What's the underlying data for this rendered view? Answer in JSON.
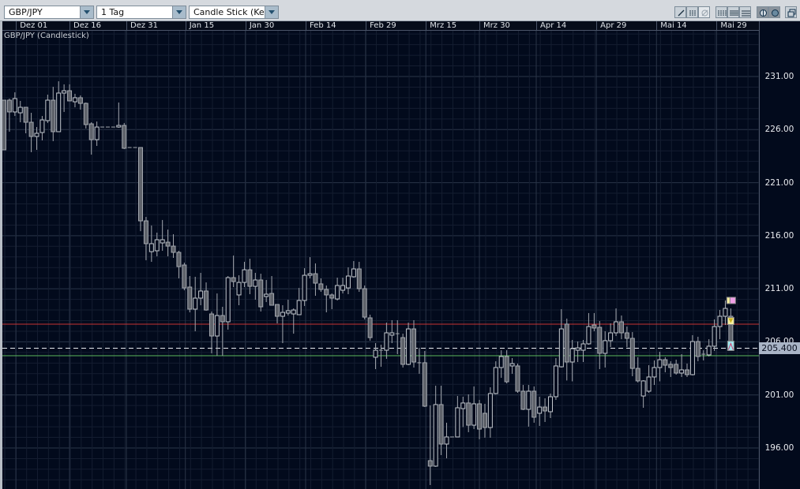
{
  "toolbar": {
    "symbol": "GBP/JPY",
    "interval": "1 Tag",
    "chart_type": "Candle Stick (Kerze",
    "tools": [
      "line-tool-icon",
      "horizontal-lines-icon",
      "disabled-circle-icon",
      "grid-lines-icon",
      "lines-icon",
      "dashed-lines-icon",
      "circle-settings-icon",
      "pattern-circle-icon",
      "detach-window-icon"
    ]
  },
  "chart_title": "GBP/JPY (Candlestick)",
  "colors": {
    "background": "#020a1c",
    "red_line": "#c83232",
    "green_line": "#5cb85c",
    "last_price_box": "#a9b4c6",
    "marker_pink": "#f0a0e8",
    "marker_yellow": "#f8f0a0",
    "marker_cyan": "#a0e8f0"
  },
  "chart_data": {
    "type": "candlestick",
    "title": "GBP/JPY (Candlestick)",
    "ylim": [
      191.5,
      235.0
    ],
    "y_ticks": [
      "231.00",
      "226.00",
      "221.00",
      "216.00",
      "211.00",
      "206.00",
      "201.00",
      "196.00"
    ],
    "x_ticks": [
      {
        "label": "Dez 01",
        "candle_index": 2.2
      },
      {
        "label": "Dez 16",
        "candle_index": 12
      },
      {
        "label": "Dez 31",
        "candle_index": 22.4
      },
      {
        "label": "Jan 15",
        "candle_index": 33.2
      },
      {
        "label": "Jan 30",
        "candle_index": 44.2
      },
      {
        "label": "Feb 14",
        "candle_index": 55.2
      },
      {
        "label": "Feb 29",
        "candle_index": 66.2
      },
      {
        "label": "Mrz 15",
        "candle_index": 77.2
      },
      {
        "label": "Mrz 30",
        "candle_index": 87
      },
      {
        "label": "Apr 14",
        "candle_index": 97.4
      },
      {
        "label": "Apr 29",
        "candle_index": 108.4
      },
      {
        "label": "Mai 14",
        "candle_index": 119.4
      },
      {
        "label": "Mai 29",
        "candle_index": 130.4
      }
    ],
    "last_price": "205.400",
    "last_price_value": 205.4,
    "horizontal_lines": [
      {
        "price": 207.67,
        "color": "red"
      },
      {
        "price": 204.69,
        "color": "green"
      }
    ],
    "markers": [
      {
        "price": 209.9,
        "color": "pink"
      },
      {
        "price": 208.0,
        "color": "yellow"
      },
      {
        "price": 205.7,
        "color": "cyan"
      }
    ],
    "ohlc": [
      [
        228.77,
        228.77,
        224.09,
        224.09
      ],
      [
        228.77,
        228.92,
        225.8,
        227.66
      ],
      [
        227.66,
        229.51,
        227.28,
        228.92
      ],
      [
        227.58,
        228.7,
        226.69,
        228.1
      ],
      [
        228.1,
        228.1,
        225.65,
        226.69
      ],
      [
        226.69,
        227.58,
        223.87,
        225.35
      ],
      [
        225.35,
        226.24,
        224.09,
        225.65
      ],
      [
        225.72,
        227.28,
        224.98,
        226.91
      ],
      [
        226.84,
        229.29,
        226.62,
        228.77
      ],
      [
        228.77,
        230.03,
        224.91,
        225.8
      ],
      [
        225.8,
        230.55,
        225.8,
        229.44
      ],
      [
        229.44,
        230.26,
        227.66,
        229.66
      ],
      [
        229.66,
        230.26,
        228.7,
        228.7
      ],
      [
        228.62,
        229.37,
        228.1,
        229.0
      ],
      [
        229.0,
        229.22,
        227.88,
        228.47
      ],
      [
        228.47,
        228.55,
        226.1,
        226.47
      ],
      [
        226.54,
        226.69,
        223.64,
        225.05
      ],
      [
        225.05,
        226.76,
        224.46,
        226.24
      ],
      [
        226.24,
        226.24,
        226.24,
        226.24
      ],
      [
        226.24,
        226.24,
        226.24,
        226.24
      ],
      [
        226.24,
        226.24,
        226.24,
        226.24
      ],
      [
        226.24,
        228.55,
        226.17,
        226.39
      ],
      [
        226.39,
        226.62,
        224.16,
        224.24
      ],
      [
        224.31,
        224.31,
        224.31,
        224.31
      ],
      [
        224.31,
        224.31,
        224.31,
        224.31
      ],
      [
        224.31,
        224.31,
        216.43,
        217.4
      ],
      [
        217.4,
        217.77,
        213.69,
        215.25
      ],
      [
        214.5,
        216.96,
        213.54,
        215.25
      ],
      [
        214.58,
        216.29,
        214.06,
        215.62
      ],
      [
        215.32,
        217.48,
        214.58,
        215.62
      ],
      [
        215.39,
        216.58,
        214.06,
        215.02
      ],
      [
        215.02,
        216.14,
        213.91,
        214.43
      ],
      [
        214.43,
        214.58,
        211.98,
        213.09
      ],
      [
        213.24,
        213.46,
        210.86,
        211.08
      ],
      [
        211.16,
        212.2,
        208.78,
        209.08
      ],
      [
        209.08,
        212.13,
        207.0,
        210.12
      ],
      [
        210.12,
        212.5,
        209.45,
        210.79
      ],
      [
        210.79,
        211.6,
        208.93,
        209.0
      ],
      [
        208.63,
        208.86,
        204.92,
        206.55
      ],
      [
        206.55,
        210.56,
        204.69,
        208.48
      ],
      [
        208.48,
        209.3,
        204.69,
        207.89
      ],
      [
        207.89,
        212.2,
        207.15,
        212.05
      ],
      [
        212.05,
        214.13,
        211.16,
        211.68
      ],
      [
        210.42,
        212.27,
        209.45,
        211.6
      ],
      [
        211.6,
        213.54,
        211.16,
        212.79
      ],
      [
        212.79,
        213.83,
        210.49,
        211.23
      ],
      [
        211.23,
        212.5,
        209.97,
        211.83
      ],
      [
        211.83,
        212.42,
        208.86,
        209.3
      ],
      [
        210.27,
        211.83,
        209.75,
        210.49
      ],
      [
        210.56,
        212.2,
        209.45,
        209.45
      ],
      [
        209.52,
        209.52,
        207.74,
        208.41
      ],
      [
        208.41,
        209.45,
        205.88,
        208.78
      ],
      [
        208.71,
        209.97,
        208.48,
        208.93
      ],
      [
        208.63,
        209.15,
        206.77,
        209.0
      ],
      [
        208.56,
        211.08,
        208.56,
        209.9
      ],
      [
        209.9,
        212.94,
        209.38,
        212.27
      ],
      [
        212.27,
        213.98,
        211.98,
        212.42
      ],
      [
        212.42,
        213.39,
        210.34,
        211.53
      ],
      [
        211.46,
        211.98,
        210.71,
        210.94
      ],
      [
        210.94,
        211.31,
        208.78,
        210.42
      ],
      [
        210.42,
        210.56,
        209.08,
        210.12
      ],
      [
        210.04,
        212.05,
        209.9,
        211.31
      ],
      [
        210.86,
        212.05,
        210.56,
        211.31
      ],
      [
        211.08,
        213.02,
        210.49,
        212.2
      ],
      [
        212.13,
        213.61,
        212.05,
        212.87
      ],
      [
        212.87,
        213.54,
        210.71,
        211.01
      ],
      [
        211.01,
        211.31,
        208.11,
        208.33
      ],
      [
        208.26,
        208.56,
        206.11,
        206.4
      ],
      [
        204.55,
        205.88,
        203.43,
        205.21
      ],
      [
        205.21,
        205.73,
        203.65,
        205.21
      ],
      [
        205.21,
        207.81,
        204.4,
        206.85
      ],
      [
        206.63,
        208.04,
        205.88,
        206.85
      ],
      [
        206.77,
        208.04,
        204.84,
        206.77
      ],
      [
        206.4,
        206.77,
        203.58,
        203.88
      ],
      [
        203.88,
        207.81,
        203.8,
        207.22
      ],
      [
        207.22,
        208.04,
        203.58,
        204.1
      ],
      [
        204.03,
        205.43,
        202.99,
        204.03
      ],
      [
        204.03,
        205.14,
        199.86,
        199.94
      ],
      [
        194.81,
        200.01,
        192.51,
        194.29
      ],
      [
        194.29,
        201.87,
        194.22,
        200.09
      ],
      [
        200.09,
        201.87,
        195.33,
        196.37
      ],
      [
        196.37,
        198.38,
        195.03,
        197.04
      ],
      [
        197.04,
        197.04,
        197.04,
        197.04
      ],
      [
        197.04,
        200.9,
        197.04,
        199.79
      ],
      [
        199.71,
        200.83,
        197.97,
        200.24
      ],
      [
        200.24,
        201.05,
        197.49,
        198.15
      ],
      [
        198.15,
        201.8,
        197.78,
        200.16
      ],
      [
        200.16,
        200.53,
        196.82,
        197.78
      ],
      [
        199.27,
        200.16,
        196.97,
        197.93
      ],
      [
        197.93,
        201.72,
        196.97,
        201.13
      ],
      [
        201.13,
        204.17,
        201.05,
        203.58
      ],
      [
        203.58,
        205.21,
        202.61,
        204.62
      ],
      [
        204.62,
        205.21,
        202.09,
        202.24
      ],
      [
        203.73,
        204.47,
        202.99,
        203.95
      ],
      [
        203.73,
        203.95,
        201.2,
        201.35
      ],
      [
        201.35,
        201.94,
        199.57,
        199.64
      ],
      [
        199.64,
        201.94,
        198.01,
        201.35
      ],
      [
        201.35,
        201.8,
        198.38,
        198.9
      ],
      [
        199.27,
        200.83,
        198.08,
        199.86
      ],
      [
        199.86,
        200.68,
        198.45,
        199.49
      ],
      [
        199.42,
        201.13,
        198.82,
        200.83
      ],
      [
        200.83,
        204.47,
        200.53,
        203.73
      ],
      [
        203.65,
        209.08,
        203.58,
        207.22
      ],
      [
        207.67,
        208.19,
        202.36,
        204.1
      ],
      [
        204.1,
        206.18,
        202.28,
        205.36
      ],
      [
        205.21,
        206.03,
        204.1,
        205.43
      ],
      [
        205.21,
        206.18,
        204.1,
        205.81
      ],
      [
        205.81,
        208.71,
        205.73,
        207.44
      ],
      [
        207.59,
        208.71,
        207.0,
        207.3
      ],
      [
        207.37,
        207.96,
        203.43,
        204.92
      ],
      [
        204.92,
        207.0,
        203.58,
        206.11
      ],
      [
        206.11,
        207.74,
        205.51,
        206.85
      ],
      [
        206.85,
        209.15,
        206.55,
        207.89
      ],
      [
        207.89,
        208.48,
        206.25,
        206.85
      ],
      [
        206.85,
        207.44,
        205.51,
        206.33
      ],
      [
        206.33,
        206.92,
        202.76,
        203.5
      ],
      [
        203.5,
        204.55,
        202.17,
        202.32
      ],
      [
        200.9,
        202.39,
        199.79,
        202.32
      ],
      [
        201.35,
        203.8,
        201.2,
        202.69
      ],
      [
        202.69,
        204.25,
        201.94,
        203.58
      ],
      [
        203.58,
        205.06,
        202.28,
        204.32
      ],
      [
        204.32,
        204.55,
        203.13,
        203.8
      ],
      [
        203.88,
        204.17,
        202.69,
        203.58
      ],
      [
        203.88,
        204.32,
        202.91,
        203.06
      ],
      [
        203.06,
        204.84,
        202.69,
        203.36
      ],
      [
        203.36,
        203.95,
        202.69,
        202.91
      ],
      [
        202.91,
        206.63,
        202.84,
        206.03
      ],
      [
        206.03,
        206.48,
        204.17,
        204.62
      ],
      [
        204.84,
        205.21,
        204.25,
        204.84
      ],
      [
        204.77,
        206.25,
        204.62,
        205.59
      ],
      [
        205.59,
        208.11,
        205.14,
        207.44
      ],
      [
        207.44,
        209.0,
        206.25,
        208.41
      ],
      [
        208.41,
        209.9,
        207.59,
        209.15
      ],
      [
        208.41,
        209.15,
        205.36,
        205.4
      ]
    ]
  }
}
